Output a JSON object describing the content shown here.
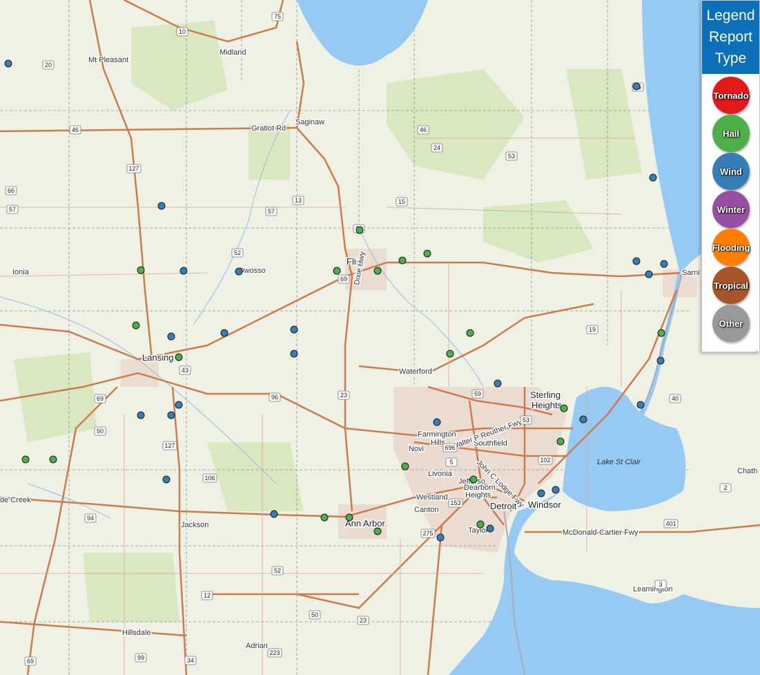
{
  "legend": {
    "title_line1": "Legend",
    "title_line2": "Report",
    "title_line3": "Type",
    "items": [
      {
        "label": "Tornado",
        "color": "#e31a1c"
      },
      {
        "label": "Hail",
        "color": "#4daf4a"
      },
      {
        "label": "Wind",
        "color": "#377eb8"
      },
      {
        "label": "Winter",
        "color": "#984ea3"
      },
      {
        "label": "Flooding",
        "color": "#ff7f00"
      },
      {
        "label": "Tropical",
        "color": "#a65628"
      },
      {
        "label": "Other",
        "color": "#999999"
      }
    ]
  },
  "places": {
    "mt_pleasant": "Mt Pleasant",
    "midland": "Midland",
    "saginaw": "Saginaw",
    "ionia": "Ionia",
    "owosso": "Owosso",
    "flint": "Flint",
    "lansing": "Lansing",
    "waterford": "Waterford",
    "sterling_heights_1": "Sterling",
    "sterling_heights_2": "Heights",
    "farmington_hills_1": "Farmington",
    "farmington_hills_2": "Hills",
    "southfield": "Southfield",
    "novi": "Novi",
    "livonia": "Livonia",
    "dearborn_heights_1": "Dearborn",
    "dearborn_heights_2": "Heights",
    "westland": "Westland",
    "canton": "Canton",
    "detroit": "Detroit",
    "windsor": "Windsor",
    "lake_st_clair": "Lake St Clair",
    "ann_arbor": "Ann Arbor",
    "jackson": "Jackson",
    "taylor": "Taylor",
    "battle_creek": "de Creek",
    "hillsdale": "Hillsdale",
    "adrian": "Adrian",
    "leamington": "Leamington",
    "sarnia": "Sarni",
    "chatham": "Chath",
    "gratiot_rd": "Gratiot Rd",
    "mcdonald_cartier": "McDonald-Cartier Fwy",
    "jefferson": "Jefferso",
    "walter_reuther": "Walter P Reuther Fwy",
    "john_lodge": "John C Lodge Fwy",
    "dixie_hwy": "Dixie Hwy"
  },
  "shields": [
    "75",
    "10",
    "20",
    "46",
    "127",
    "66",
    "57",
    "57",
    "13",
    "15",
    "24",
    "53",
    "46",
    "25",
    "52",
    "69",
    "19",
    "69",
    "96",
    "23",
    "59",
    "43",
    "53",
    "50",
    "127",
    "106",
    "12",
    "52",
    "50",
    "23",
    "94",
    "275",
    "102",
    "2",
    "401",
    "40",
    "3",
    "99",
    "34",
    "223",
    "69",
    "696",
    "5",
    "153",
    "24"
  ],
  "reports": {
    "hail": [
      [
        521,
        333
      ],
      [
        619,
        367
      ],
      [
        583,
        377
      ],
      [
        547,
        392
      ],
      [
        488,
        392
      ],
      [
        681,
        482
      ],
      [
        652,
        512
      ],
      [
        204,
        391
      ],
      [
        197,
        471
      ],
      [
        259,
        517
      ],
      [
        817,
        591
      ],
      [
        812,
        639
      ],
      [
        686,
        694
      ],
      [
        696,
        759
      ],
      [
        587,
        675
      ],
      [
        506,
        749
      ],
      [
        470,
        749
      ],
      [
        547,
        769
      ],
      [
        37,
        665
      ],
      [
        77,
        665
      ],
      [
        958,
        482
      ]
    ],
    "wind": [
      [
        12,
        92
      ],
      [
        234,
        298
      ],
      [
        266,
        392
      ],
      [
        346,
        393
      ],
      [
        426,
        477
      ],
      [
        426,
        512
      ],
      [
        325,
        482
      ],
      [
        248,
        487
      ],
      [
        204,
        601
      ],
      [
        248,
        601
      ],
      [
        259,
        586
      ],
      [
        241,
        694
      ],
      [
        397,
        744
      ],
      [
        638,
        778
      ],
      [
        710,
        765
      ],
      [
        784,
        714
      ],
      [
        805,
        709
      ],
      [
        721,
        555
      ],
      [
        633,
        611
      ],
      [
        845,
        607
      ],
      [
        928,
        586
      ],
      [
        922,
        378
      ],
      [
        940,
        397
      ],
      [
        962,
        382
      ],
      [
        946,
        257
      ],
      [
        922,
        125
      ],
      [
        957,
        522
      ]
    ]
  }
}
